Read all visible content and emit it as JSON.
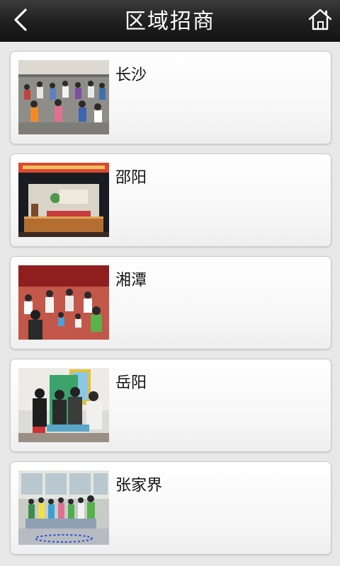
{
  "header": {
    "title": "区域招商",
    "back_icon": "back-arrow-icon",
    "home_icon": "home-icon"
  },
  "regions": [
    {
      "name": "长沙"
    },
    {
      "name": "邵阳"
    },
    {
      "name": "湘潭"
    },
    {
      "name": "岳阳"
    },
    {
      "name": "张家界"
    }
  ]
}
